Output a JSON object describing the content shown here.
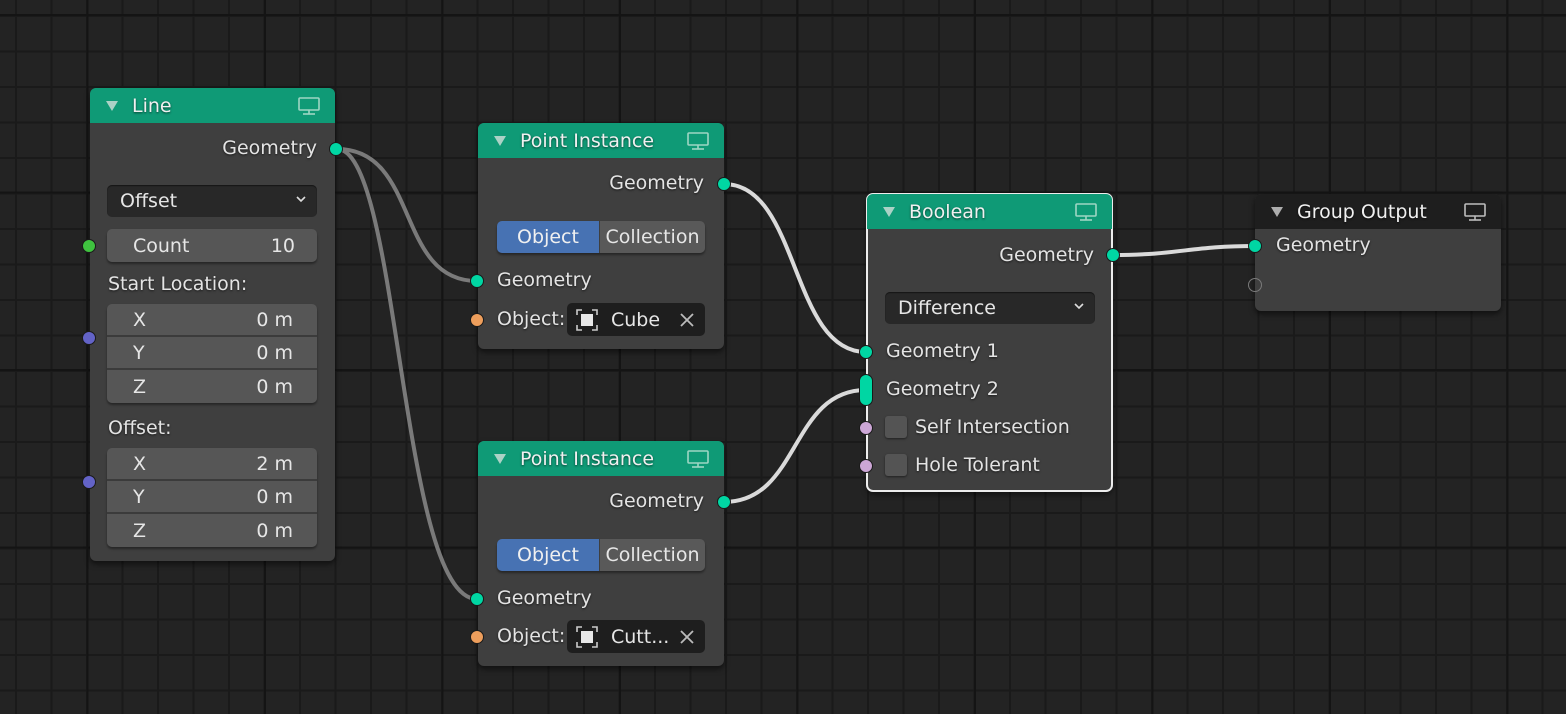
{
  "editor": "Geometry Node Editor",
  "colors": {
    "header_geometry": "#0f9a76",
    "header_group": "#1e1e1e",
    "socket_geometry": "#00d6a3",
    "socket_integer": "#3fc23f",
    "socket_vector": "#6363c7",
    "socket_object": "#ed9e5c",
    "socket_boolean": "#cca6d6",
    "toggle_active": "#4772b3"
  },
  "nodes": {
    "line": {
      "title": "Line",
      "output": "Geometry",
      "mode": "Offset",
      "count_label": "Count",
      "count_value": "10",
      "start_label": "Start Location:",
      "start": [
        {
          "axis": "X",
          "value": "0 m"
        },
        {
          "axis": "Y",
          "value": "0 m"
        },
        {
          "axis": "Z",
          "value": "0 m"
        }
      ],
      "offset_label": "Offset:",
      "offset": [
        {
          "axis": "X",
          "value": "2 m"
        },
        {
          "axis": "Y",
          "value": "0 m"
        },
        {
          "axis": "Z",
          "value": "0 m"
        }
      ]
    },
    "point_instance_1": {
      "title": "Point Instance",
      "output": "Geometry",
      "toggle": {
        "selected": "Object",
        "other": "Collection"
      },
      "input_geometry": "Geometry",
      "object_label": "Object:",
      "object_value": "Cube"
    },
    "point_instance_2": {
      "title": "Point Instance",
      "output": "Geometry",
      "toggle": {
        "selected": "Object",
        "other": "Collection"
      },
      "input_geometry": "Geometry",
      "object_label": "Object:",
      "object_value": "Cutt..."
    },
    "boolean": {
      "title": "Boolean",
      "output": "Geometry",
      "operation": "Difference",
      "input_1": "Geometry 1",
      "input_2": "Geometry 2",
      "self_intersection": {
        "label": "Self Intersection",
        "checked": false
      },
      "hole_tolerant": {
        "label": "Hole Tolerant",
        "checked": false
      }
    },
    "group_output": {
      "title": "Group Output",
      "input": "Geometry"
    }
  },
  "links": [
    {
      "from": "line.Geometry",
      "to": "point_instance_1.Geometry"
    },
    {
      "from": "line.Geometry",
      "to": "point_instance_2.Geometry"
    },
    {
      "from": "point_instance_1.Geometry",
      "to": "boolean.Geometry 1"
    },
    {
      "from": "point_instance_2.Geometry",
      "to": "boolean.Geometry 2"
    },
    {
      "from": "boolean.Geometry",
      "to": "group_output.Geometry"
    }
  ]
}
